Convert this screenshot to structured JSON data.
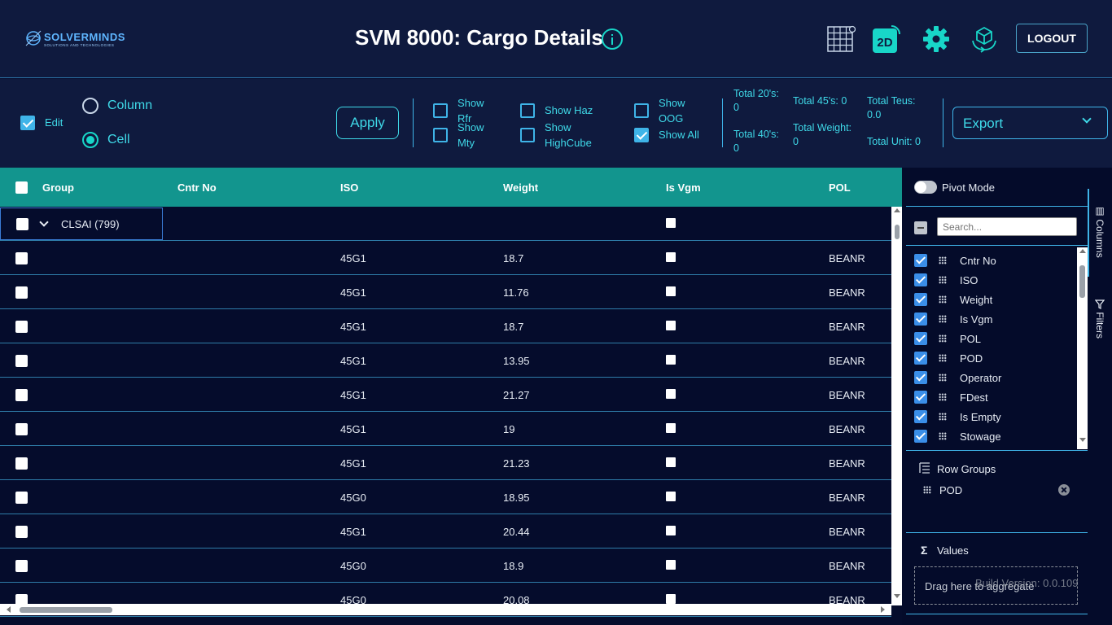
{
  "header": {
    "logo_text": "SOLVERMINDS",
    "logo_sub": "SOLUTIONS AND TECHNOLOGIES",
    "title": "SVM 8000: Cargo Details",
    "view_2d_label": "2D",
    "logout_label": "LOGOUT"
  },
  "toolbar": {
    "edit_label": "Edit",
    "edit_checked": true,
    "mode_column_label": "Column",
    "mode_cell_label": "Cell",
    "selected_mode": "Cell",
    "apply_label": "Apply",
    "filters": {
      "show_rfr": "Show Rfr",
      "show_mty": "Show Mty",
      "show_haz": "Show Haz",
      "show_highcube": "Show HighCube",
      "show_oog": "Show OOG",
      "show_all": "Show All"
    },
    "stats": {
      "total_20_label": "Total 20's:",
      "total_20": "0",
      "total_40_label": "Total 40's:",
      "total_40": "0",
      "total_45": "Total 45's: 0",
      "total_weight_label": "Total Weight:",
      "total_weight": "0",
      "total_teus_label": "Total Teus:",
      "total_teus": "0.0",
      "total_unit": "Total Unit: 0"
    },
    "export_label": "Export"
  },
  "grid": {
    "columns": [
      "Group",
      "Cntr No",
      "ISO",
      "Weight",
      "Is Vgm",
      "POL"
    ],
    "group_row": {
      "label": "CLSAI (799)"
    },
    "rows": [
      {
        "iso": "45G1",
        "weight": "18.7",
        "pol": "BEANR"
      },
      {
        "iso": "45G1",
        "weight": "11.76",
        "pol": "BEANR"
      },
      {
        "iso": "45G1",
        "weight": "18.7",
        "pol": "BEANR"
      },
      {
        "iso": "45G1",
        "weight": "13.95",
        "pol": "BEANR"
      },
      {
        "iso": "45G1",
        "weight": "21.27",
        "pol": "BEANR"
      },
      {
        "iso": "45G1",
        "weight": "19",
        "pol": "BEANR"
      },
      {
        "iso": "45G1",
        "weight": "21.23",
        "pol": "BEANR"
      },
      {
        "iso": "45G0",
        "weight": "18.95",
        "pol": "BEANR"
      },
      {
        "iso": "45G1",
        "weight": "20.44",
        "pol": "BEANR"
      },
      {
        "iso": "45G0",
        "weight": "18.9",
        "pol": "BEANR"
      },
      {
        "iso": "45G0",
        "weight": "20.08",
        "pol": "BEANR"
      }
    ]
  },
  "side_panel": {
    "pivot_mode_label": "Pivot Mode",
    "search_placeholder": "Search...",
    "columns": [
      "Cntr No",
      "ISO",
      "Weight",
      "Is Vgm",
      "POL",
      "POD",
      "Operator",
      "FDest",
      "Is Empty",
      "Stowage"
    ],
    "row_groups_label": "Row Groups",
    "row_groups": [
      "POD"
    ],
    "values_label": "Values",
    "values_placeholder": "Drag here to aggregate",
    "tab_columns": "Columns",
    "tab_filters": "Filters"
  },
  "footer": {
    "build_version": "Build Version: 0.0.109"
  },
  "colors": {
    "accent": "#3fd9e8",
    "header_bg": "#12958e",
    "page_bg": "#0a1033"
  },
  "icons": [
    "grid-settings-icon",
    "view-2d-icon",
    "gear-icon",
    "cube-rotate-icon",
    "info-icon",
    "chevron-down-icon",
    "grip-icon",
    "remove-icon",
    "sigma-icon",
    "row-groups-icon",
    "filter-icon",
    "columns-icon"
  ]
}
